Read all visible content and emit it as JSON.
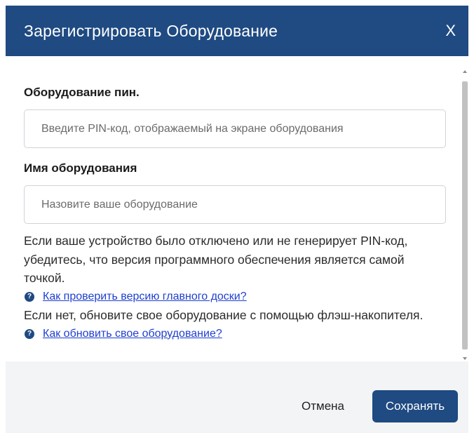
{
  "modal": {
    "title": "Зарегистрировать Оборудование",
    "close_label": "X"
  },
  "form": {
    "pin": {
      "label": "Оборудование пин.",
      "placeholder": "Введите PIN-код, отображаемый на экране оборудования",
      "value": ""
    },
    "name": {
      "label": "Имя оборудования",
      "placeholder": "Назовите ваше оборудование",
      "value": ""
    }
  },
  "help": {
    "text1": "Если ваше устройство было отключено или не генерирует PIN-код, убедитесь, что версия программного обеспечения является самой точкой.",
    "link1": "Как проверить версию главного доски?",
    "text2": "Если нет, обновите свое оборудование с помощью флэш-накопителя.",
    "link2": "Как обновить свое оборудование?",
    "icon": "question-circle-icon",
    "icon_glyph": "?"
  },
  "footer": {
    "cancel_label": "Отмена",
    "save_label": "Сохранять"
  },
  "colors": {
    "primary": "#1f4a82",
    "link": "#1f3fcf",
    "footer_bg": "#f3f4f6"
  }
}
